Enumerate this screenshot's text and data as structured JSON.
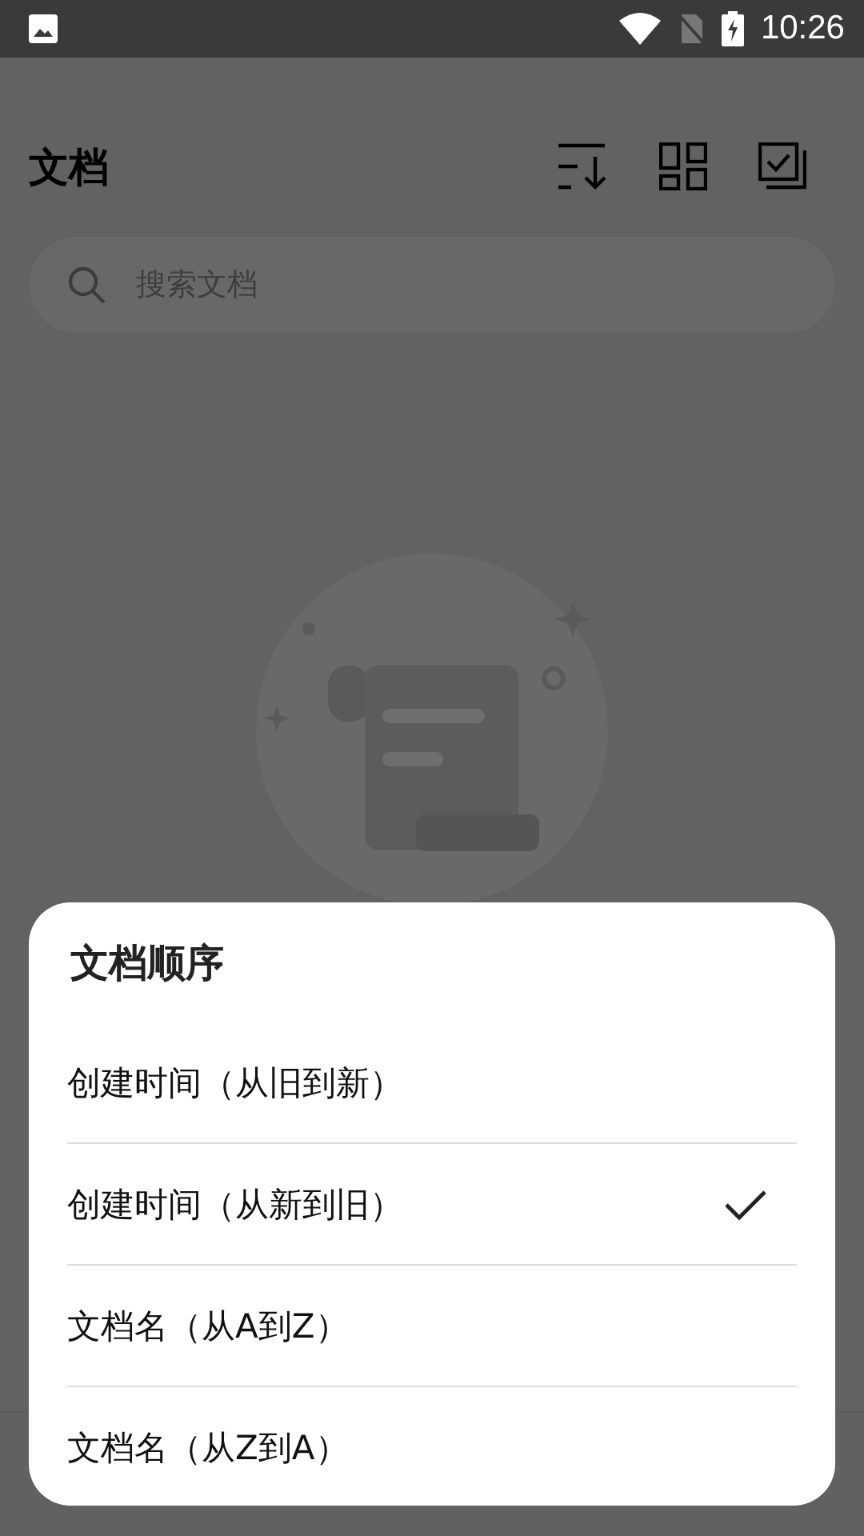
{
  "status_bar": {
    "time": "10:26"
  },
  "header": {
    "title": "文档"
  },
  "search": {
    "placeholder": "搜索文档"
  },
  "sort_sheet": {
    "title": "文档顺序",
    "options": [
      {
        "label": "创建时间（从旧到新）",
        "selected": false
      },
      {
        "label": "创建时间（从新到旧）",
        "selected": true
      },
      {
        "label": "文档名（从A到Z）",
        "selected": false
      },
      {
        "label": "文档名（从Z到A）",
        "selected": false
      }
    ]
  }
}
